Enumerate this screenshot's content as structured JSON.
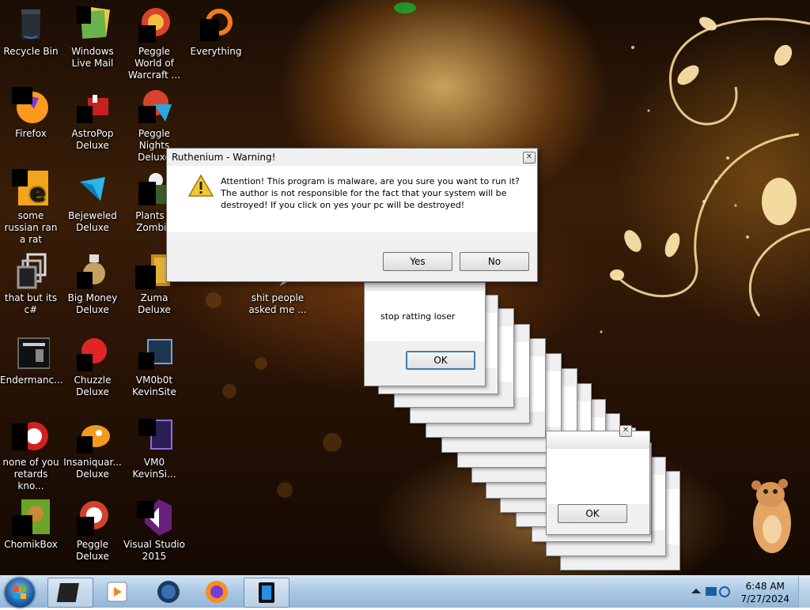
{
  "desktop_icons": [
    {
      "id": "recycle-bin",
      "label": "Recycle Bin"
    },
    {
      "id": "windows-live-mail",
      "label": "Windows Live Mail"
    },
    {
      "id": "peggle-world-of-warcraft",
      "label": "Peggle World of Warcraft ..."
    },
    {
      "id": "everything",
      "label": "Everything"
    },
    {
      "id": "firefox",
      "label": "Firefox"
    },
    {
      "id": "astropop-deluxe",
      "label": "AstroPop Deluxe"
    },
    {
      "id": "peggle-nights-deluxe",
      "label": "Peggle Nights Deluxe"
    },
    {
      "id": "some-russian-ran-a-rat",
      "label": "some russian ran a rat"
    },
    {
      "id": "bejeweled-deluxe",
      "label": "Bejeweled Deluxe"
    },
    {
      "id": "plants-vs-zombies",
      "label": "Plants v Zombie"
    },
    {
      "id": "that-but-its-c",
      "label": "that but its c#"
    },
    {
      "id": "big-money-deluxe",
      "label": "Big Money Deluxe"
    },
    {
      "id": "zuma-deluxe",
      "label": "Zuma Deluxe"
    },
    {
      "id": "shit-people",
      "label": "shit people asked me ..."
    },
    {
      "id": "endermanch",
      "label": "Endermanc..."
    },
    {
      "id": "chuzzle-deluxe",
      "label": "Chuzzle Deluxe"
    },
    {
      "id": "vm0b0t-kevinsite",
      "label": "VM0b0t KevinSite"
    },
    {
      "id": "none-of-you",
      "label": "none of you retards kno..."
    },
    {
      "id": "insaniquarium-deluxe",
      "label": "Insaniquar... Deluxe"
    },
    {
      "id": "vm0-kevinsite",
      "label": "VM0 KevinSi..."
    },
    {
      "id": "chomikbox",
      "label": "ChomikBox"
    },
    {
      "id": "peggle-deluxe",
      "label": "Peggle Deluxe"
    },
    {
      "id": "visual-studio-2015",
      "label": "Visual Studio 2015"
    }
  ],
  "warning_dialog": {
    "title": "Ruthenium - Warning!",
    "message": "Attention! This program is malware, are you sure you want to run it? The author is not responsible for the fact that your system will be destroyed! If you click on yes your pc will be destroyed!",
    "yes_label": "Yes",
    "no_label": "No",
    "close_glyph": "✕"
  },
  "stop_dialog": {
    "message": "stop ratting loser",
    "ok_label": "OK"
  },
  "back_dialog": {
    "ok_label": "OK"
  },
  "taskbar": {
    "time": "6:48 AM",
    "date": "7/27/2024",
    "colors": {
      "accent": "#3c7fb1",
      "bar": "#a8c7e3"
    }
  }
}
